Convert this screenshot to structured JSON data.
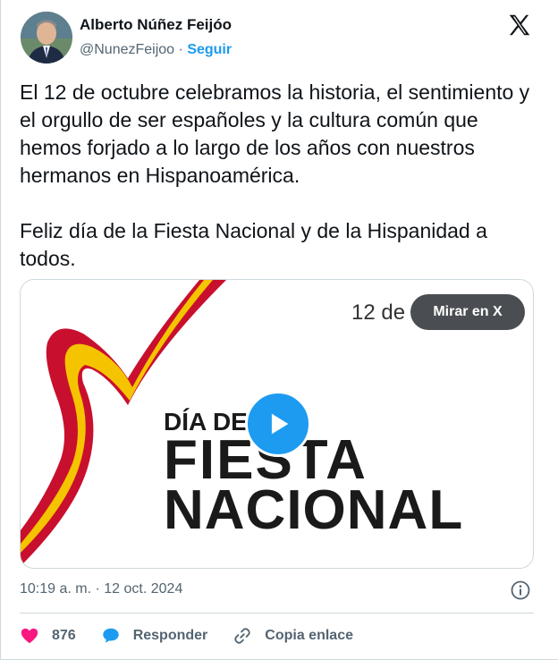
{
  "author": {
    "name": "Alberto Núñez Feijóo",
    "handle": "@NunezFeijoo",
    "separator": "·",
    "follow_label": "Seguir"
  },
  "platform_icon": "x-logo-icon",
  "tweet": {
    "paragraph1": "El 12 de octubre celebramos la historia, el sentimiento y el orgullo de ser españoles y la cultura común que hemos forjado a lo largo de los años con nuestros hermanos en Hispanoamérica.",
    "paragraph2": "Feliz día de la Fiesta Nacional y de la Hispanidad a todos."
  },
  "media": {
    "corner_text": "12 de",
    "watch_label": "Mirar en X",
    "title_small": "DÍA DE",
    "title_line1": "FIESTA",
    "title_line2": "NACIONAL",
    "play_icon": "play-icon",
    "colors": {
      "red": "#c8102e",
      "yellow": "#f5c400",
      "dark_text": "#1a1a1a"
    }
  },
  "meta": {
    "time": "10:19 a. m.",
    "separator": "·",
    "date": "12 oct. 2024"
  },
  "actions": {
    "likes": "876",
    "reply_label": "Responder",
    "copy_label": "Copia enlace"
  },
  "colors": {
    "accent": "#1d9bf0",
    "like": "#f91880",
    "muted": "#536471"
  }
}
